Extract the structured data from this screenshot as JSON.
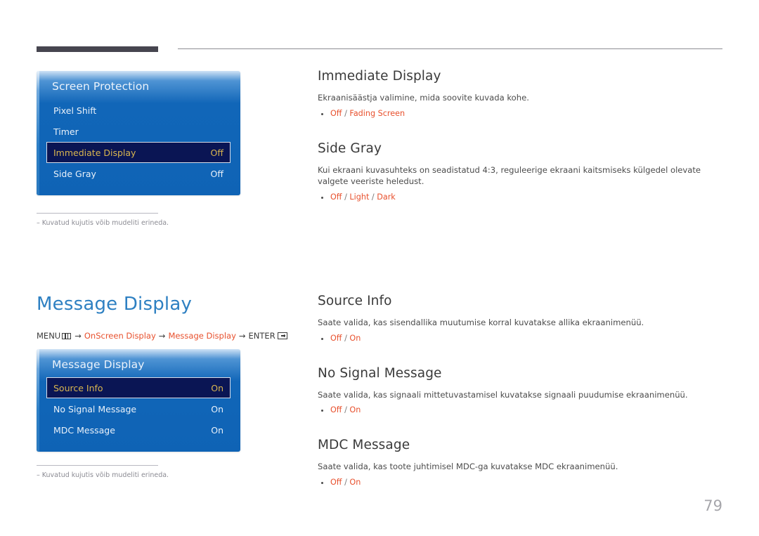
{
  "page": {
    "number": "79"
  },
  "figure_note": "–  Kuvatud kujutis võib mudeliti erineda.",
  "osd_panels": [
    {
      "id": "screen-protection",
      "title": "Screen Protection",
      "rows": [
        {
          "label": "Pixel Shift",
          "value": "",
          "selected": false
        },
        {
          "label": "Timer",
          "value": "",
          "selected": false
        },
        {
          "label": "Immediate Display",
          "value": "Off",
          "selected": true
        },
        {
          "label": "Side Gray",
          "value": "Off",
          "selected": false
        }
      ]
    },
    {
      "id": "message-display",
      "title": "Message Display",
      "rows": [
        {
          "label": "Source Info",
          "value": "On",
          "selected": true
        },
        {
          "label": "No Signal Message",
          "value": "On",
          "selected": false
        },
        {
          "label": "MDC Message",
          "value": "On",
          "selected": false
        }
      ]
    }
  ],
  "section": {
    "title": "Message Display",
    "breadcrumb": {
      "menu_label": "MENU",
      "menu_icon": "menu-grid-icon",
      "arrow": "→",
      "step1": "OnScreen Display",
      "step2": "Message Display",
      "enter_label": "ENTER",
      "enter_icon": "enter-return-icon"
    }
  },
  "topics_top": [
    {
      "id": "immediate-display",
      "heading": "Immediate Display",
      "description": "Ekraanisäästja valimine, mida soovite kuvada kohe.",
      "options": [
        "Off",
        "Fading Screen"
      ]
    },
    {
      "id": "side-gray",
      "heading": "Side Gray",
      "description": "Kui ekraani kuvasuhteks on seadistatud 4:3, reguleerige ekraani kaitsmiseks külgedel olevate valgete veeriste heledust.",
      "options": [
        "Off",
        "Light",
        "Dark"
      ]
    }
  ],
  "topics_bottom": [
    {
      "id": "source-info",
      "heading": "Source Info",
      "description": "Saate valida, kas sisendallika muutumise korral kuvatakse allika ekraanimenüü.",
      "options": [
        "Off",
        "On"
      ]
    },
    {
      "id": "no-signal-message",
      "heading": "No Signal Message",
      "description": "Saate valida, kas signaali mittetuvastamisel kuvatakse signaali puudumise ekraanimenüü.",
      "options": [
        "Off",
        "On"
      ]
    },
    {
      "id": "mdc-message",
      "heading": "MDC Message",
      "description": "Saate valida, kas toote juhtimisel MDC-ga kuvatakse MDC ekraanimenüü.",
      "options": [
        "Off",
        "On"
      ]
    }
  ],
  "colors": {
    "accent_blue": "#2e80c2",
    "option_orange": "#e8512e",
    "osd_blue": "#0f63b5",
    "osd_selected_bg": "#0a1554",
    "osd_selected_text": "#d9b64f",
    "rule_dark": "#46454f",
    "page_number": "#a6a6ab"
  }
}
